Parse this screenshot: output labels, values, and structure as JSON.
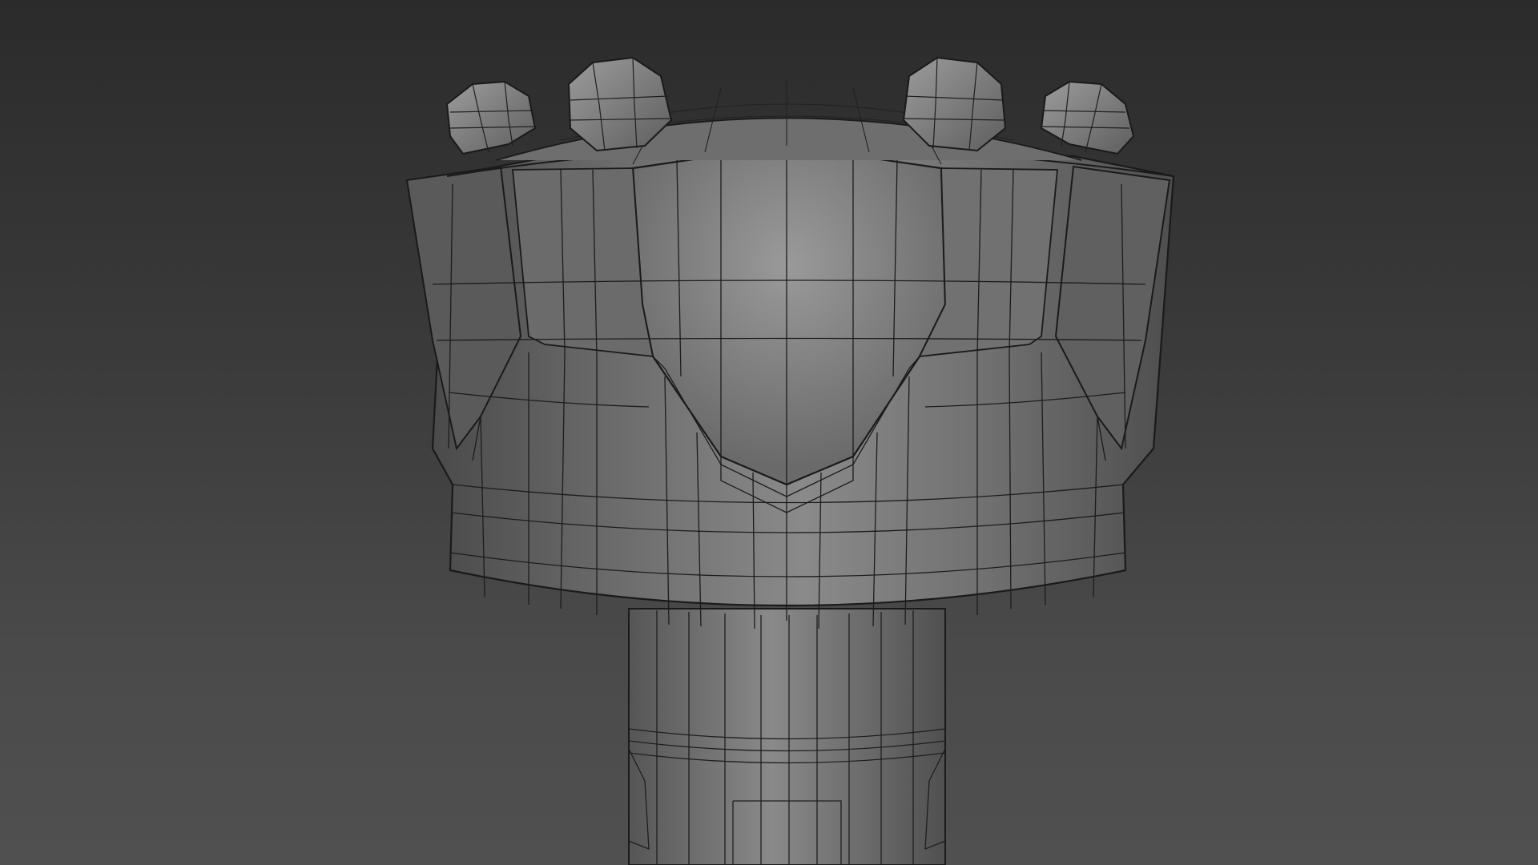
{
  "viewport": {
    "view": "perspective",
    "shading": "smooth-shaded-with-edged-faces",
    "background_top": "#2b2b2b",
    "background_bottom": "#505050"
  },
  "model": {
    "object": "tower-top-polygon-mesh",
    "display": "wireframe-over-shaded",
    "wire_color": "#1a1a1a",
    "surface_color": "#7a7a7a"
  }
}
